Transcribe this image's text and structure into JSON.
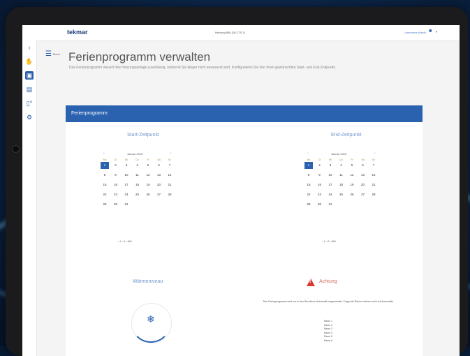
{
  "header": {
    "logo": "tekmar",
    "device": "Heizung 808 (28 CTS-1)",
    "user": "Username Admin"
  },
  "rail": {
    "back_icon": "‹",
    "items": [
      "✋",
      "▣",
      "▤",
      "⚙"
    ]
  },
  "menu": {
    "label": "Menu"
  },
  "page": {
    "title": "Ferienprogramm verwalten",
    "description": "Das Ferienprogramm steuert Ihre Heizungsanlage zuverlässig, während Sie länger nicht anwesend sind. Konfigurieren Sie hier Ihren gewünschten Start- und End-Zeitpunkt."
  },
  "panel": {
    "title": "Ferienprogramm"
  },
  "start": {
    "title": "Start-Zeitpunkt",
    "month": "Januar 2015",
    "prev": "‹",
    "next": "›",
    "dow": [
      "Mo",
      "Di",
      "Mi",
      "Do",
      "Fr",
      "Sa",
      "So"
    ],
    "weeks": [
      [
        "1",
        "2",
        "3",
        "4",
        "5",
        "6",
        "7"
      ],
      [
        "8",
        "9",
        "10",
        "11",
        "12",
        "13",
        "14"
      ],
      [
        "15",
        "16",
        "17",
        "18",
        "19",
        "20",
        "21"
      ],
      [
        "22",
        "23",
        "24",
        "25",
        "26",
        "27",
        "28"
      ],
      [
        "29",
        "30",
        "31",
        "",
        "",
        "",
        ""
      ]
    ],
    "selected": "1",
    "time": "‹ 4 : 0 ›  AM"
  },
  "end": {
    "title": "End-Zeitpunkt",
    "month": "Januar 2015",
    "prev": "‹",
    "next": "›",
    "dow": [
      "Mo",
      "Di",
      "Mi",
      "Do",
      "Fr",
      "Sa",
      "So"
    ],
    "weeks": [
      [
        "1",
        "2",
        "3",
        "4",
        "5",
        "6",
        "7"
      ],
      [
        "8",
        "9",
        "10",
        "11",
        "12",
        "13",
        "14"
      ],
      [
        "15",
        "16",
        "17",
        "18",
        "19",
        "20",
        "21"
      ],
      [
        "22",
        "23",
        "24",
        "25",
        "26",
        "27",
        "28"
      ],
      [
        "29",
        "30",
        "31",
        "",
        "",
        "",
        ""
      ]
    ],
    "selected": "1",
    "time": "‹ 4 : 0 ›  AM"
  },
  "warm": {
    "title": "Wärmeniveau",
    "icon": "snowflake-icon"
  },
  "warning": {
    "title": "Achtung",
    "text": "Das Ferienprogramm wird nur in den Bereichen Automatik angewendet. Folgende Räume stehen nicht auf Automatik:",
    "rooms": [
      "Raum 1",
      "Raum 2",
      "Raum 3",
      "Raum 4",
      "Raum 5",
      "Raum 6"
    ]
  },
  "colors": {
    "accent": "#2a62b0",
    "warning": "#d63b2e"
  }
}
